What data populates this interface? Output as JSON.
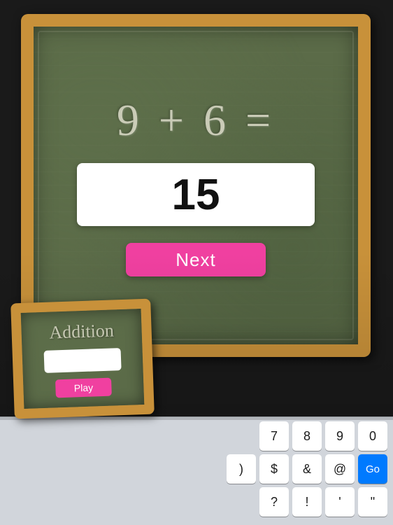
{
  "main_board": {
    "equation": "9 + 6 =",
    "answer": "15"
  },
  "next_button": {
    "label": "Next"
  },
  "small_board": {
    "title": "Addition",
    "play_label": "Play"
  },
  "keyboard": {
    "row1": [
      "7",
      "8",
      "9",
      "0"
    ],
    "row2": [
      ")",
      "$",
      "&",
      "@"
    ],
    "row3": [
      "?",
      "!",
      "'",
      "\""
    ],
    "go_label": "Go"
  }
}
